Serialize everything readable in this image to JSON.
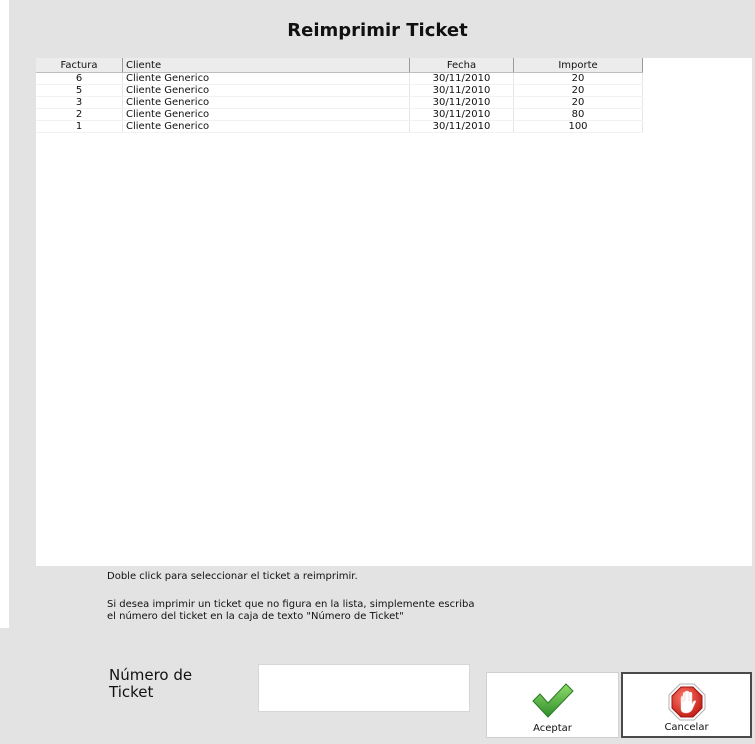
{
  "title": "Reimprimir Ticket",
  "table": {
    "columns": [
      "Factura",
      "Cliente",
      "Fecha",
      "Importe"
    ],
    "rows": [
      {
        "factura": "6",
        "cliente": "Cliente Generico",
        "fecha": "30/11/2010",
        "importe": "20"
      },
      {
        "factura": "5",
        "cliente": "Cliente Generico",
        "fecha": "30/11/2010",
        "importe": "20"
      },
      {
        "factura": "3",
        "cliente": "Cliente Generico",
        "fecha": "30/11/2010",
        "importe": "20"
      },
      {
        "factura": "2",
        "cliente": "Cliente Generico",
        "fecha": "30/11/2010",
        "importe": "80"
      },
      {
        "factura": "1",
        "cliente": "Cliente Generico",
        "fecha": "30/11/2010",
        "importe": "100"
      }
    ]
  },
  "hints": {
    "double_click": "Doble click para seleccionar el ticket a reimprimir.",
    "manual_line1": "Si desea imprimir un ticket que no figura en la lista, simplemente escriba",
    "manual_line2": "el número del ticket en la caja de texto \"Número de Ticket\""
  },
  "ticket_field": {
    "label_line1": "Número de",
    "label_line2": "Ticket",
    "value": ""
  },
  "buttons": {
    "accept": {
      "label": "Aceptar",
      "icon": "checkmark-icon",
      "color": "#3aa63a"
    },
    "cancel": {
      "label": "Cancelar",
      "icon": "stop-hand-icon",
      "color": "#d8261e"
    }
  }
}
